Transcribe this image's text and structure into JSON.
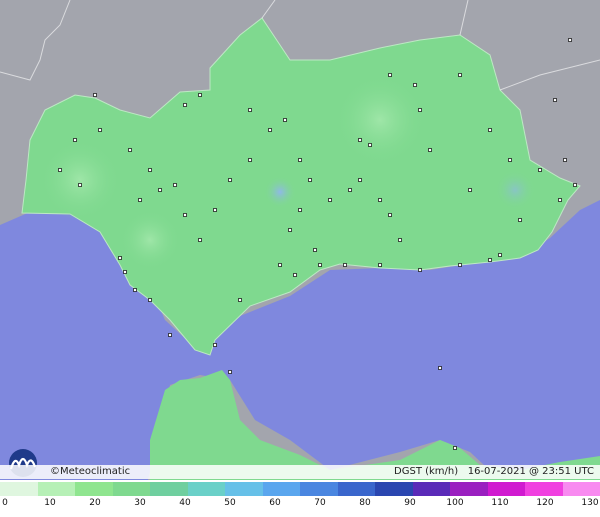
{
  "credit": "©Meteoclimatic",
  "variable": "DGST (km/h)",
  "timestamp": "16-07-2021 @ 23:51 UTC",
  "legend": {
    "ticks": [
      "0",
      "10",
      "20",
      "30",
      "40",
      "50",
      "60",
      "70",
      "80",
      "90",
      "100",
      "110",
      "120",
      "130"
    ],
    "colors": [
      "#dff6df",
      "#b6f0b6",
      "#8fe58f",
      "#7fd98f",
      "#6fcf9f",
      "#6ad0c8",
      "#66c0e8",
      "#5aa6ee",
      "#4a86e0",
      "#3a66cc",
      "#2a46b0",
      "#5a2ab8",
      "#9a20c0",
      "#d01ad0",
      "#f040e0",
      "#f88af0"
    ]
  },
  "colors": {
    "land": "#7fd98f",
    "sea": "#7f88de",
    "neighbor": "#a3a5ad"
  }
}
